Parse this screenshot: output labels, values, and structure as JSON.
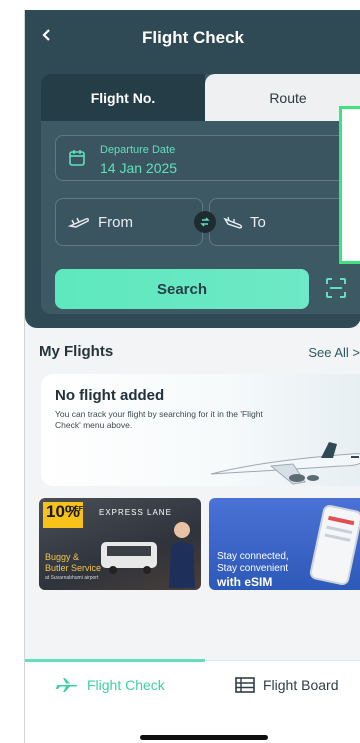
{
  "header": {
    "back_icon": "chevron-left-icon",
    "title": "Flight Check"
  },
  "tabs": [
    {
      "label": "Flight No.",
      "active": false
    },
    {
      "label": "Route",
      "active": true
    }
  ],
  "route_form": {
    "date_label": "Departure Date",
    "date_value": "14 Jan 2025",
    "from_label": "From",
    "to_label": "To",
    "search_label": "Search"
  },
  "my_flights": {
    "title": "My Flights",
    "see_all": "See All  >",
    "empty_title": "No flight added",
    "empty_desc": "You can track your flight by searching for it in the 'Flight Check' menu above."
  },
  "promos": [
    {
      "badge": "10%",
      "badge_small": "OFF",
      "tag": "EXPRESS LANE",
      "line1": "Buggy &",
      "line2": "Butler Service",
      "line3": "at Suvarnabhumi airport"
    },
    {
      "line1": "Stay connected,",
      "line2": "Stay convenient",
      "line3": "with eSIM"
    }
  ],
  "bottom_nav": [
    {
      "label": "Flight Check",
      "icon": "plane-icon",
      "active": true
    },
    {
      "label": "Flight Board",
      "icon": "board-icon",
      "active": false
    }
  ],
  "colors": {
    "header_bg": "#2f4a55",
    "accent": "#62e0bd",
    "highlight_box": "#3ee37f"
  }
}
